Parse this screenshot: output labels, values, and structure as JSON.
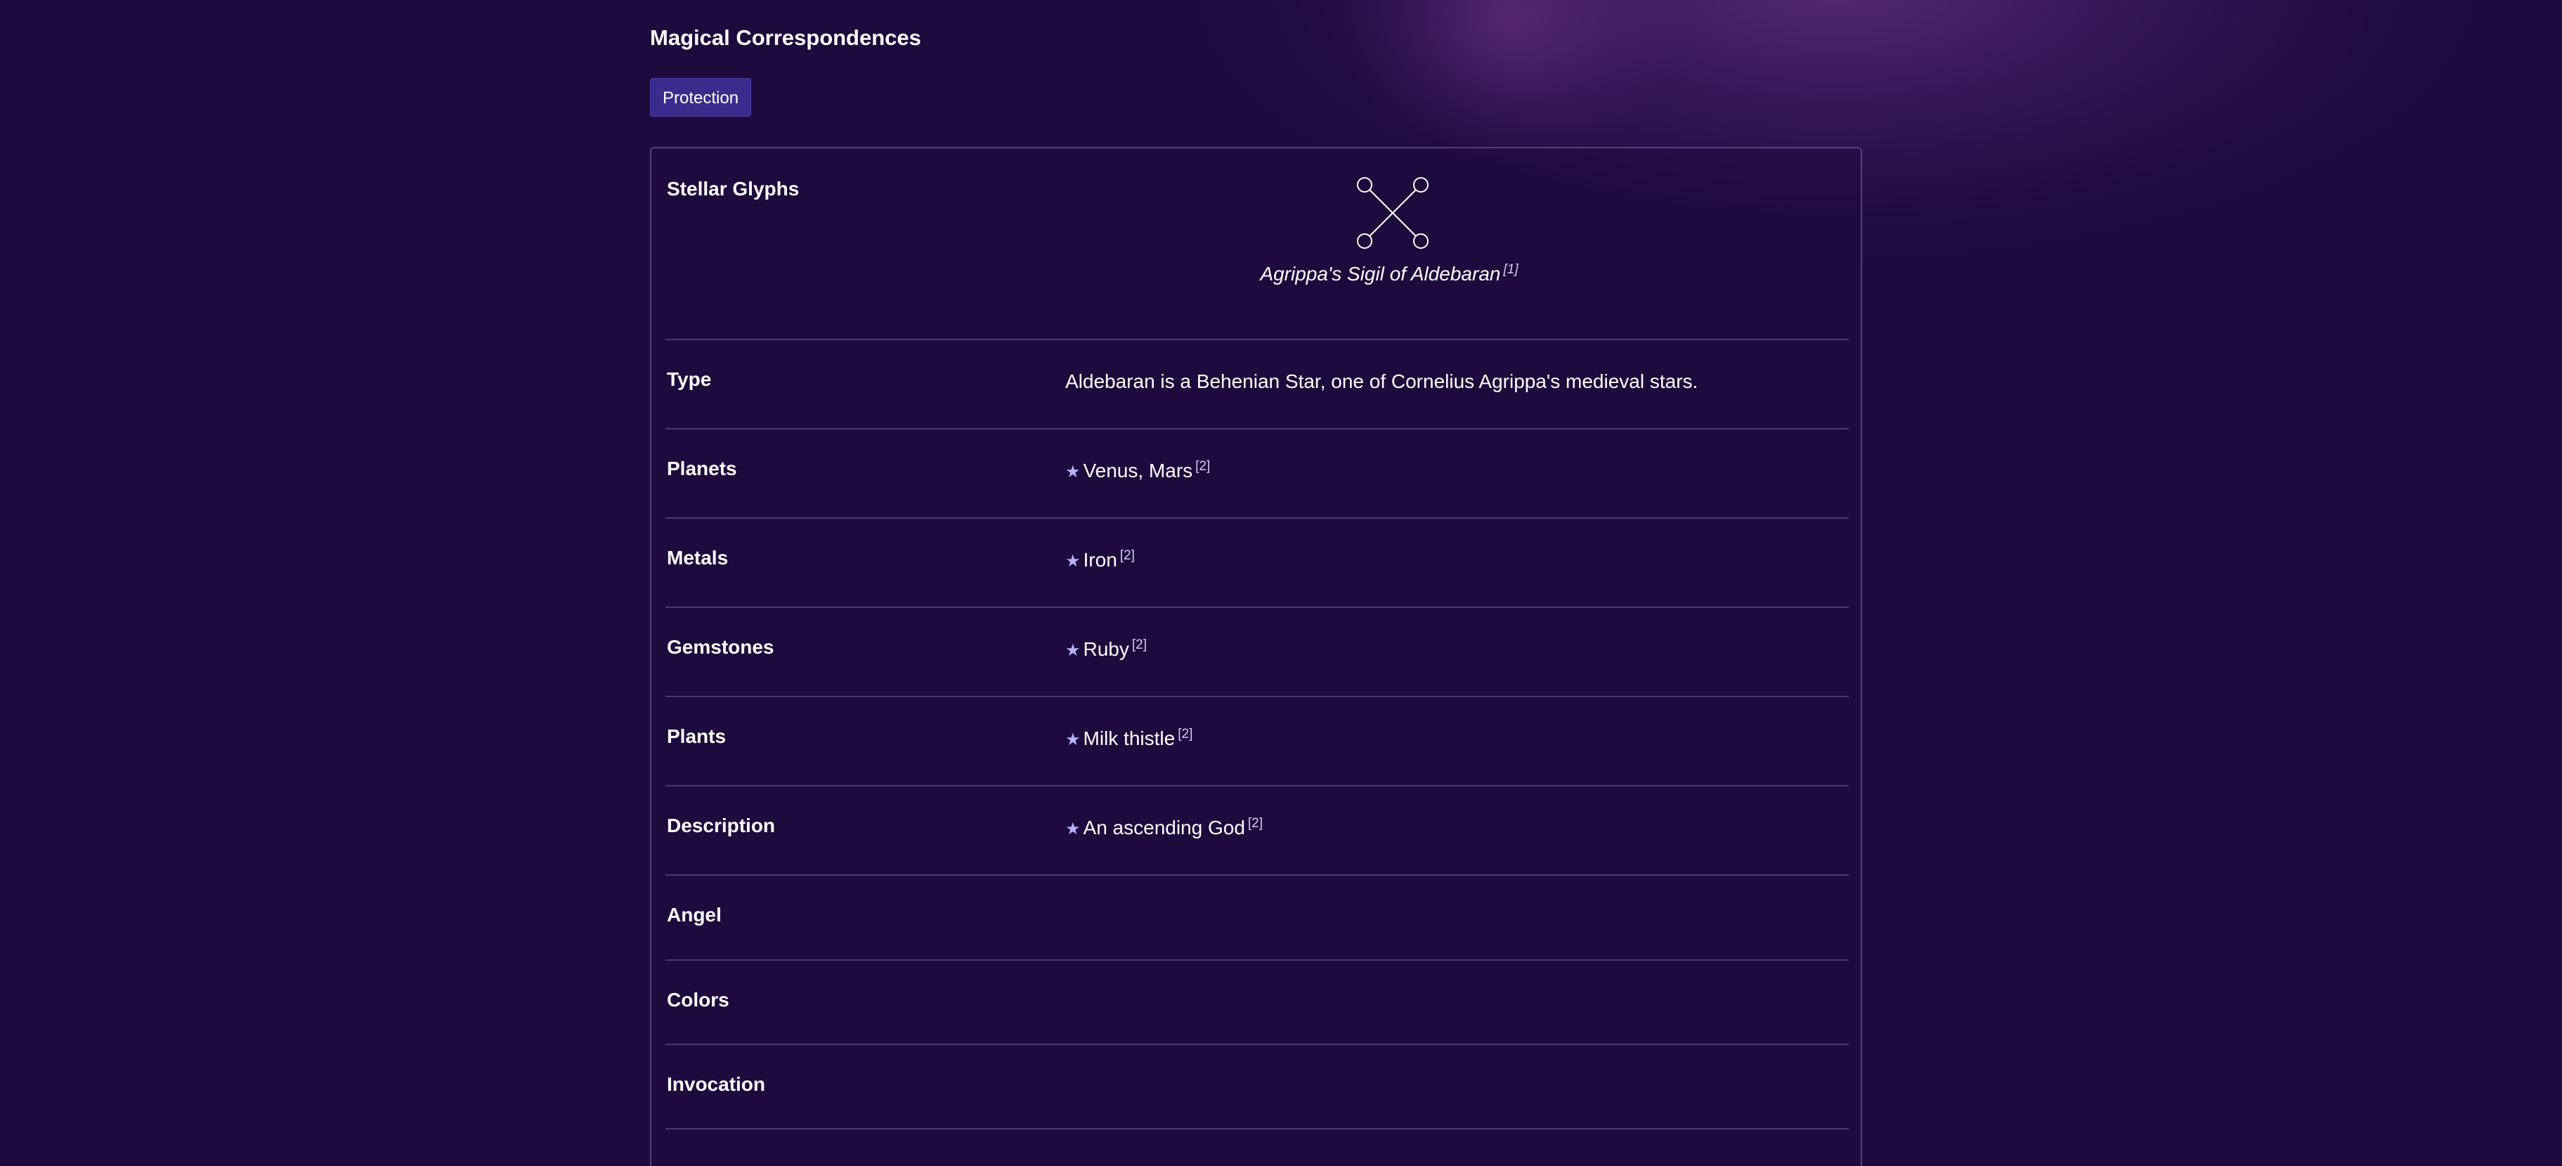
{
  "page": {
    "title": "Magical Correspondences",
    "tag_button": "Protection"
  },
  "card": {
    "glyph_row": {
      "label": "Stellar Glyphs",
      "caption": "Agrippa's Sigil of Aldebaran",
      "caption_ref": "[1]",
      "icon": "sigil-of-aldebaran"
    },
    "rows": [
      {
        "label": "Type",
        "value": "Aldebaran is a Behenian Star, one of Cornelius Agrippa's medieval stars.",
        "ref": ""
      },
      {
        "label": "Planets",
        "value": "Venus, Mars",
        "ref": "[2]"
      },
      {
        "label": "Metals",
        "value": "Iron",
        "ref": "[2]"
      },
      {
        "label": "Gemstones",
        "value": "Ruby",
        "ref": "[2]"
      },
      {
        "label": "Plants",
        "value": "Milk thistle",
        "ref": "[2]"
      },
      {
        "label": "Description",
        "value": "An ascending God",
        "ref": "[2]"
      },
      {
        "label": "Angel",
        "value": "",
        "ref": ""
      },
      {
        "label": "Colors",
        "value": "",
        "ref": ""
      },
      {
        "label": "Invocation",
        "value": "",
        "ref": ""
      }
    ],
    "bullet_icon": "star-icon",
    "bullet_char": "★"
  },
  "colors": {
    "background": "#1e0a3c",
    "button": "#3a2c8c",
    "star": "#b8b3ff",
    "divider": "#4a3a6a"
  }
}
